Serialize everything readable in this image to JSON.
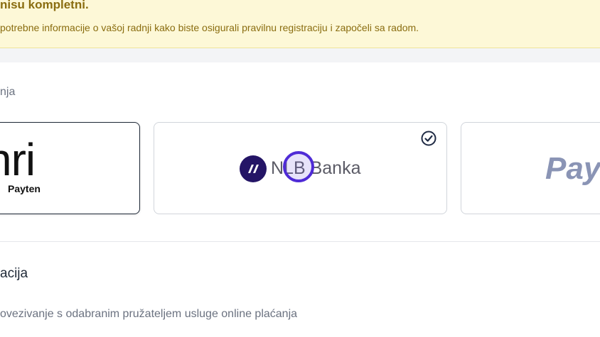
{
  "banner": {
    "title": "nisu kompletni.",
    "text": "potrebne informacije o vašoj radnji kako biste osigurali pravilnu registraciju i započeli sa radom."
  },
  "payment_section": {
    "label": "nja"
  },
  "providers": {
    "monri": {
      "word": "nri",
      "sub": "Payten",
      "selected": false
    },
    "nlb": {
      "word_prefix": "NLB ",
      "word_suffix": "Banka",
      "selected": true,
      "circle_color": "#241566"
    },
    "paypal": {
      "word": "Pay",
      "selected": false
    }
  },
  "integration": {
    "title": "acija",
    "text": "ovezivanje s odabranim pružateljem usluge online plaćanja"
  },
  "colors": {
    "banner_bg": "#fdf8d7",
    "banner_text": "#8a6d10",
    "accent": "#4f2bd6"
  }
}
